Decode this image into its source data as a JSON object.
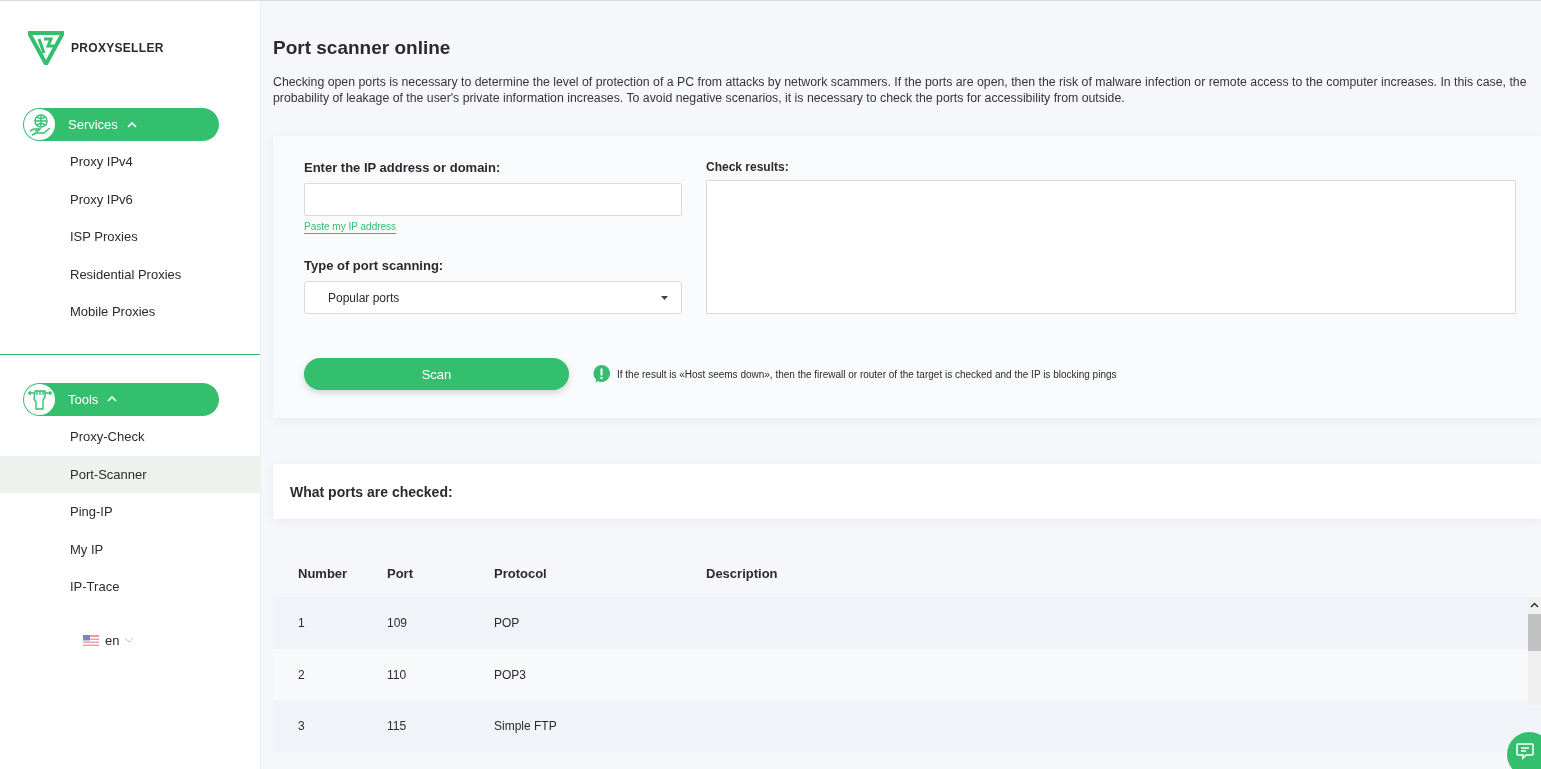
{
  "logo": {
    "text": "PROXYSELLER"
  },
  "sidebar": {
    "sections": [
      {
        "label": "Services",
        "expanded": true,
        "items": [
          {
            "label": "Proxy IPv4",
            "selected": false
          },
          {
            "label": "Proxy IPv6",
            "selected": false
          },
          {
            "label": "ISP Proxies",
            "selected": false
          },
          {
            "label": "Residential Proxies",
            "selected": false
          },
          {
            "label": "Mobile Proxies",
            "selected": false
          }
        ]
      },
      {
        "label": "Tools",
        "expanded": true,
        "items": [
          {
            "label": "Proxy-Check",
            "selected": false
          },
          {
            "label": "Port-Scanner",
            "selected": true
          },
          {
            "label": "Ping-IP",
            "selected": false
          },
          {
            "label": "My IP",
            "selected": false
          },
          {
            "label": "IP-Trace",
            "selected": false
          }
        ]
      }
    ],
    "language": "en"
  },
  "page": {
    "title": "Port scanner online",
    "intro": "Checking open ports is necessary to determine the level of protection of a PC from attacks by network scammers. If the ports are open, then the risk of malware infection or remote access to the computer increases. In this case, the probability of leakage of the user's private information increases. To avoid negative scenarios, it is necessary to check the ports for accessibility from outside."
  },
  "form": {
    "ip_label": "Enter the IP address or domain:",
    "paste_link": "Paste my IP address",
    "scan_type_label": "Type of port scanning:",
    "scan_type_value": "Popular ports",
    "results_label": "Check results:",
    "scan_button": "Scan",
    "note": "If the result is «Host seems down», then the firewall or router of the target is checked and the IP is blocking pings"
  },
  "ports_section": {
    "title": "What ports are checked:"
  },
  "table": {
    "columns": [
      "Number",
      "Port",
      "Protocol",
      "Description"
    ],
    "rows": [
      {
        "number": "1",
        "port": "109",
        "protocol": "POP"
      },
      {
        "number": "2",
        "port": "110",
        "protocol": "POP3"
      },
      {
        "number": "3",
        "port": "115",
        "protocol": "Simple FTP"
      }
    ]
  }
}
